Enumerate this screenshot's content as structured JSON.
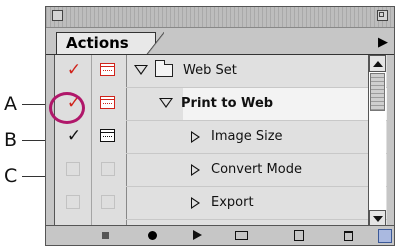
{
  "callouts": [
    {
      "letter": "A"
    },
    {
      "letter": "B"
    },
    {
      "letter": "C"
    }
  ],
  "palette": {
    "tab_label": "Actions",
    "menu_icon": "triangle-right-icon"
  },
  "rows": [
    {
      "label": "Web Set",
      "bold": false,
      "check": "red",
      "dialog": "red",
      "disclose": "down",
      "folder": true
    },
    {
      "label": "Print to Web",
      "bold": true,
      "check": "red-circled",
      "dialog": "red",
      "disclose": "down",
      "folder": false
    },
    {
      "label": "Image Size",
      "bold": false,
      "check": "black",
      "dialog": "black",
      "disclose": "right",
      "folder": false
    },
    {
      "label": "Convert Mode",
      "bold": false,
      "check": "none",
      "dialog": "none",
      "disclose": "right",
      "folder": false
    },
    {
      "label": "Export",
      "bold": false,
      "check": "none",
      "dialog": "none",
      "disclose": "right",
      "folder": false
    }
  ],
  "glyphs": {
    "checkmark": "✓"
  },
  "colors": {
    "red_check": "#d0231b",
    "black_check": "#111111",
    "callout_ring": "#b0176a"
  },
  "bottom_buttons": [
    "stop-icon",
    "record-icon",
    "play-icon",
    "new-set-icon",
    "new-action-icon",
    "trash-icon"
  ]
}
